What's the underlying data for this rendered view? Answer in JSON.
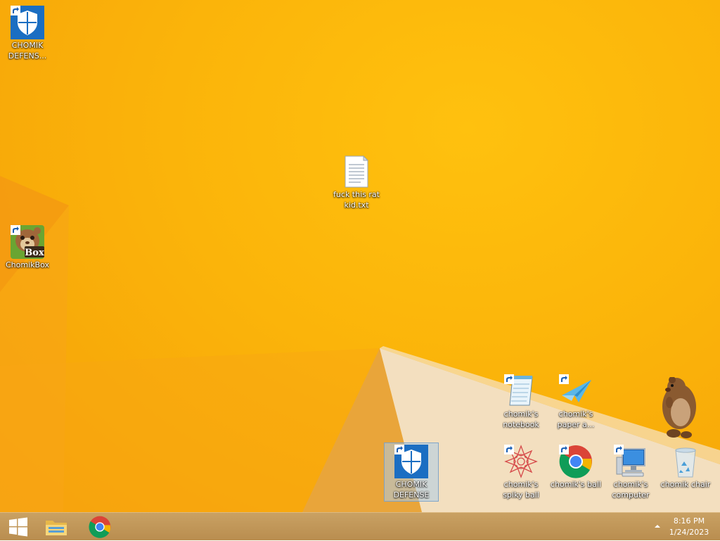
{
  "desktop": {
    "icons": [
      {
        "label": "CHOMIK DEFENS...",
        "icon": "shield-icon"
      },
      {
        "label": "fuck this rat kid.txt",
        "icon": "text-file-icon"
      },
      {
        "label": "ChomikBox",
        "icon": "hamster-box-icon",
        "badge": "Box"
      },
      {
        "label": "chomik's notebook",
        "icon": "notepad-icon"
      },
      {
        "label": "chomik's paper a...",
        "icon": "paper-airplane-icon"
      },
      {
        "label": "CHOMIK DEFENSE",
        "icon": "shield-icon"
      },
      {
        "label": "chomik's spiky ball",
        "icon": "spiky-ball-icon"
      },
      {
        "label": "chomik's ball",
        "icon": "chrome-icon"
      },
      {
        "label": "chomik's computer",
        "icon": "computer-icon"
      },
      {
        "label": "chomik chair",
        "icon": "recycle-bin-icon"
      }
    ]
  },
  "taskbar": {
    "buttons": [
      {
        "name": "start",
        "icon": "windows-logo-icon"
      },
      {
        "name": "file-explorer",
        "icon": "folder-icon"
      },
      {
        "name": "chrome",
        "icon": "chrome-icon"
      }
    ],
    "clock": {
      "time": "8:16 PM",
      "date": "1/24/2023"
    }
  },
  "colors": {
    "wallpaper": "#fbb40a",
    "taskbar": "#c09657",
    "shield": "#1b6ec2"
  }
}
